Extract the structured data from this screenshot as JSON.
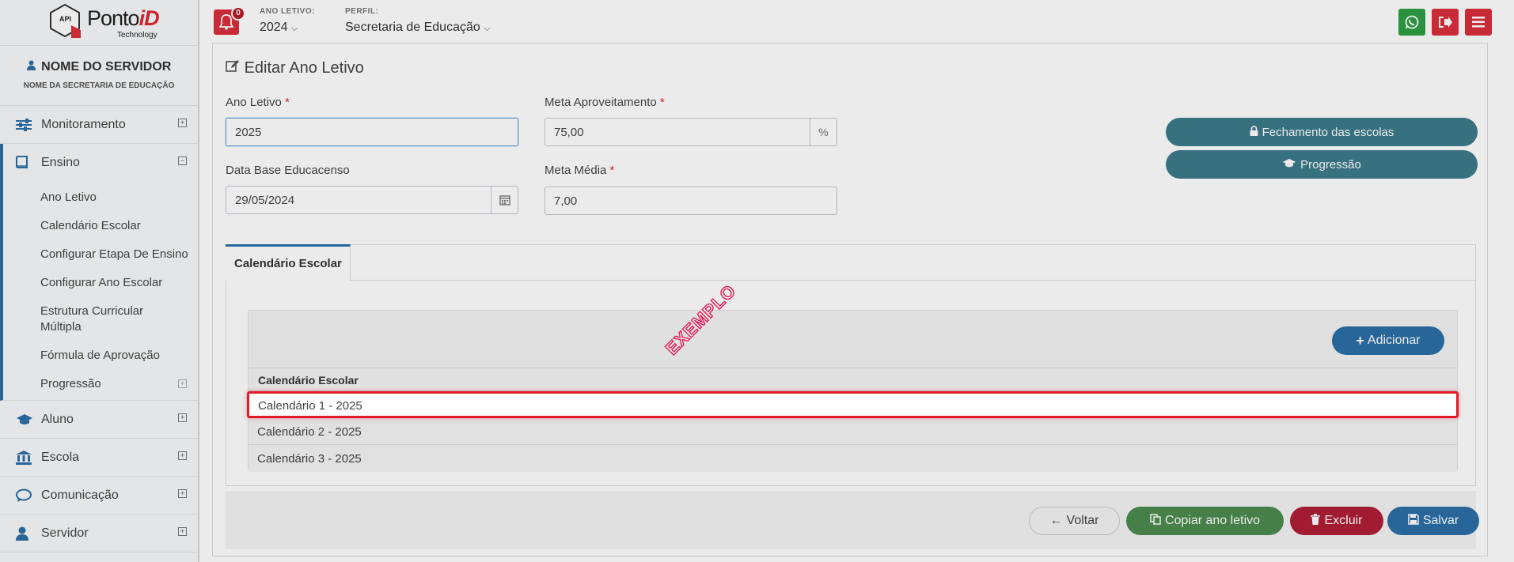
{
  "logo": {
    "brand_a": "Ponto",
    "brand_b": "iD",
    "sub": "Technology",
    "badge": "API"
  },
  "user": {
    "name": "NOME DO SERVIDOR",
    "secretaria": "NOME DA SECRETARIA DE EDUCAÇÃO"
  },
  "sidebar": {
    "items": [
      {
        "label": "Monitoramento",
        "icon": "sliders-icon"
      },
      {
        "label": "Ensino",
        "icon": "book-icon",
        "open": true
      },
      {
        "label": "Aluno",
        "icon": "graduation-cap-icon"
      },
      {
        "label": "Escola",
        "icon": "bank-icon"
      },
      {
        "label": "Comunicação",
        "icon": "chat-bubble-icon"
      },
      {
        "label": "Servidor",
        "icon": "user-icon"
      }
    ],
    "submenu": [
      "Ano Letivo",
      "Calendário Escolar",
      "Configurar Etapa De Ensino",
      "Configurar Ano Escolar",
      "Estrutura Curricular Múltipla",
      "Fórmula de Aprovação",
      "Progressão"
    ]
  },
  "topbar": {
    "notifications": "0",
    "ano_label": "ANO LETIVO:",
    "ano_value": "2024",
    "perfil_label": "PERFIL:",
    "perfil_value": "Secretaria de Educação",
    "colors": {
      "whatsapp": "#2e9e45",
      "logout": "#d92f3a",
      "menu": "#d92f3a"
    }
  },
  "form": {
    "title": "Editar Ano Letivo",
    "ano_letivo_label": "Ano Letivo",
    "ano_letivo_value": "2025",
    "meta_aprov_label": "Meta Aproveitamento",
    "meta_aprov_value": "75,00",
    "meta_aprov_unit": "%",
    "data_base_label": "Data Base Educacenso",
    "data_base_value": "29/05/2024",
    "meta_media_label": "Meta Média",
    "meta_media_value": "7,00",
    "required_mark": "*"
  },
  "side_buttons": {
    "fechamento": "Fechamento das escolas",
    "progressao": "Progressão"
  },
  "tabs": {
    "active": "Calendário Escolar"
  },
  "calendar": {
    "add_label": "Adicionar",
    "header": "Calendário Escolar",
    "rows": [
      "Calendário 1 - 2025",
      "Calendário 2 - 2025",
      "Calendário 3 - 2025"
    ]
  },
  "footer": {
    "voltar": "Voltar",
    "copiar": "Copiar ano letivo",
    "excluir": "Excluir",
    "salvar": "Salvar"
  },
  "watermark": "EXEMPLO"
}
